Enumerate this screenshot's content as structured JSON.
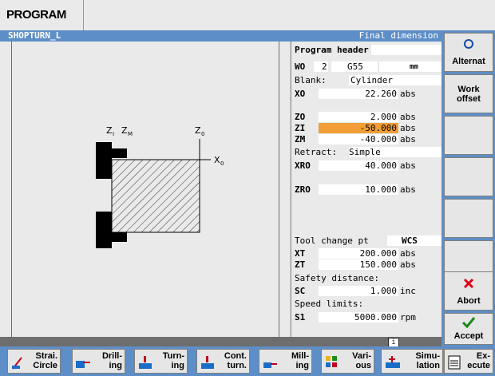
{
  "topbar": {
    "title": "PROGRAM"
  },
  "header": {
    "left": "SHOPTURN_L",
    "right": "Final dimension"
  },
  "graphic": {
    "labels": {
      "zi": "Z",
      "zi_sub": "I",
      "zm": "Z",
      "zm_sub": "M",
      "z0": "Z",
      "z0_sub": "0",
      "x0": "X",
      "x0_sub": "0"
    }
  },
  "form": {
    "program_header": "Program header",
    "wo": {
      "label": "WO",
      "value": "2",
      "offset": "G55",
      "unit": "mm"
    },
    "blank": {
      "label": "Blank:",
      "value": "Cylinder"
    },
    "x0": {
      "label": "XO",
      "value": "22.260",
      "unit": "abs"
    },
    "z0": {
      "label": "ZO",
      "value": "2.000",
      "unit": "abs"
    },
    "zi": {
      "label": "ZI",
      "value": "-50.000",
      "unit": "abs"
    },
    "zm": {
      "label": "ZM",
      "value": "-40.000",
      "unit": "abs"
    },
    "retract": {
      "label": "Retract:",
      "value": "Simple"
    },
    "xr0": {
      "label": "XRO",
      "value": "40.000",
      "unit": "abs"
    },
    "zr0": {
      "label": "ZRO",
      "value": "10.000",
      "unit": "abs"
    },
    "tool_change": {
      "label": "Tool change pt",
      "value": "WCS"
    },
    "xt": {
      "label": "XT",
      "value": "200.000",
      "unit": "abs"
    },
    "zt": {
      "label": "ZT",
      "value": "150.000",
      "unit": "abs"
    },
    "safety": {
      "label": "Safety distance:"
    },
    "sc": {
      "label": "SC",
      "value": "1.000",
      "unit": "inc"
    },
    "speed": {
      "label": "Speed limits:"
    },
    "s1": {
      "label": "S1",
      "value": "5000.000",
      "unit": "rpm"
    }
  },
  "info_icon": "i",
  "vsoftkeys": {
    "alternat": "Alternat",
    "work_offset": "Work\noffset",
    "abort": "Abort",
    "accept": "Accept"
  },
  "hsoftkeys": {
    "strai_circle": "Strai.\nCircle",
    "drilling": "Drill-\ning",
    "turning": "Turn-\ning",
    "cont_turn": "Cont.\nturn.",
    "milling": "Mill-\ning",
    "various": "Vari-\nous",
    "simulation": "Simu-\nlation",
    "execute": "Ex-\necute"
  },
  "colors": {
    "accent": "#5d8ec7",
    "highlight": "#f29e37",
    "abort": "#e0001a",
    "accept": "#1a8a1a"
  }
}
